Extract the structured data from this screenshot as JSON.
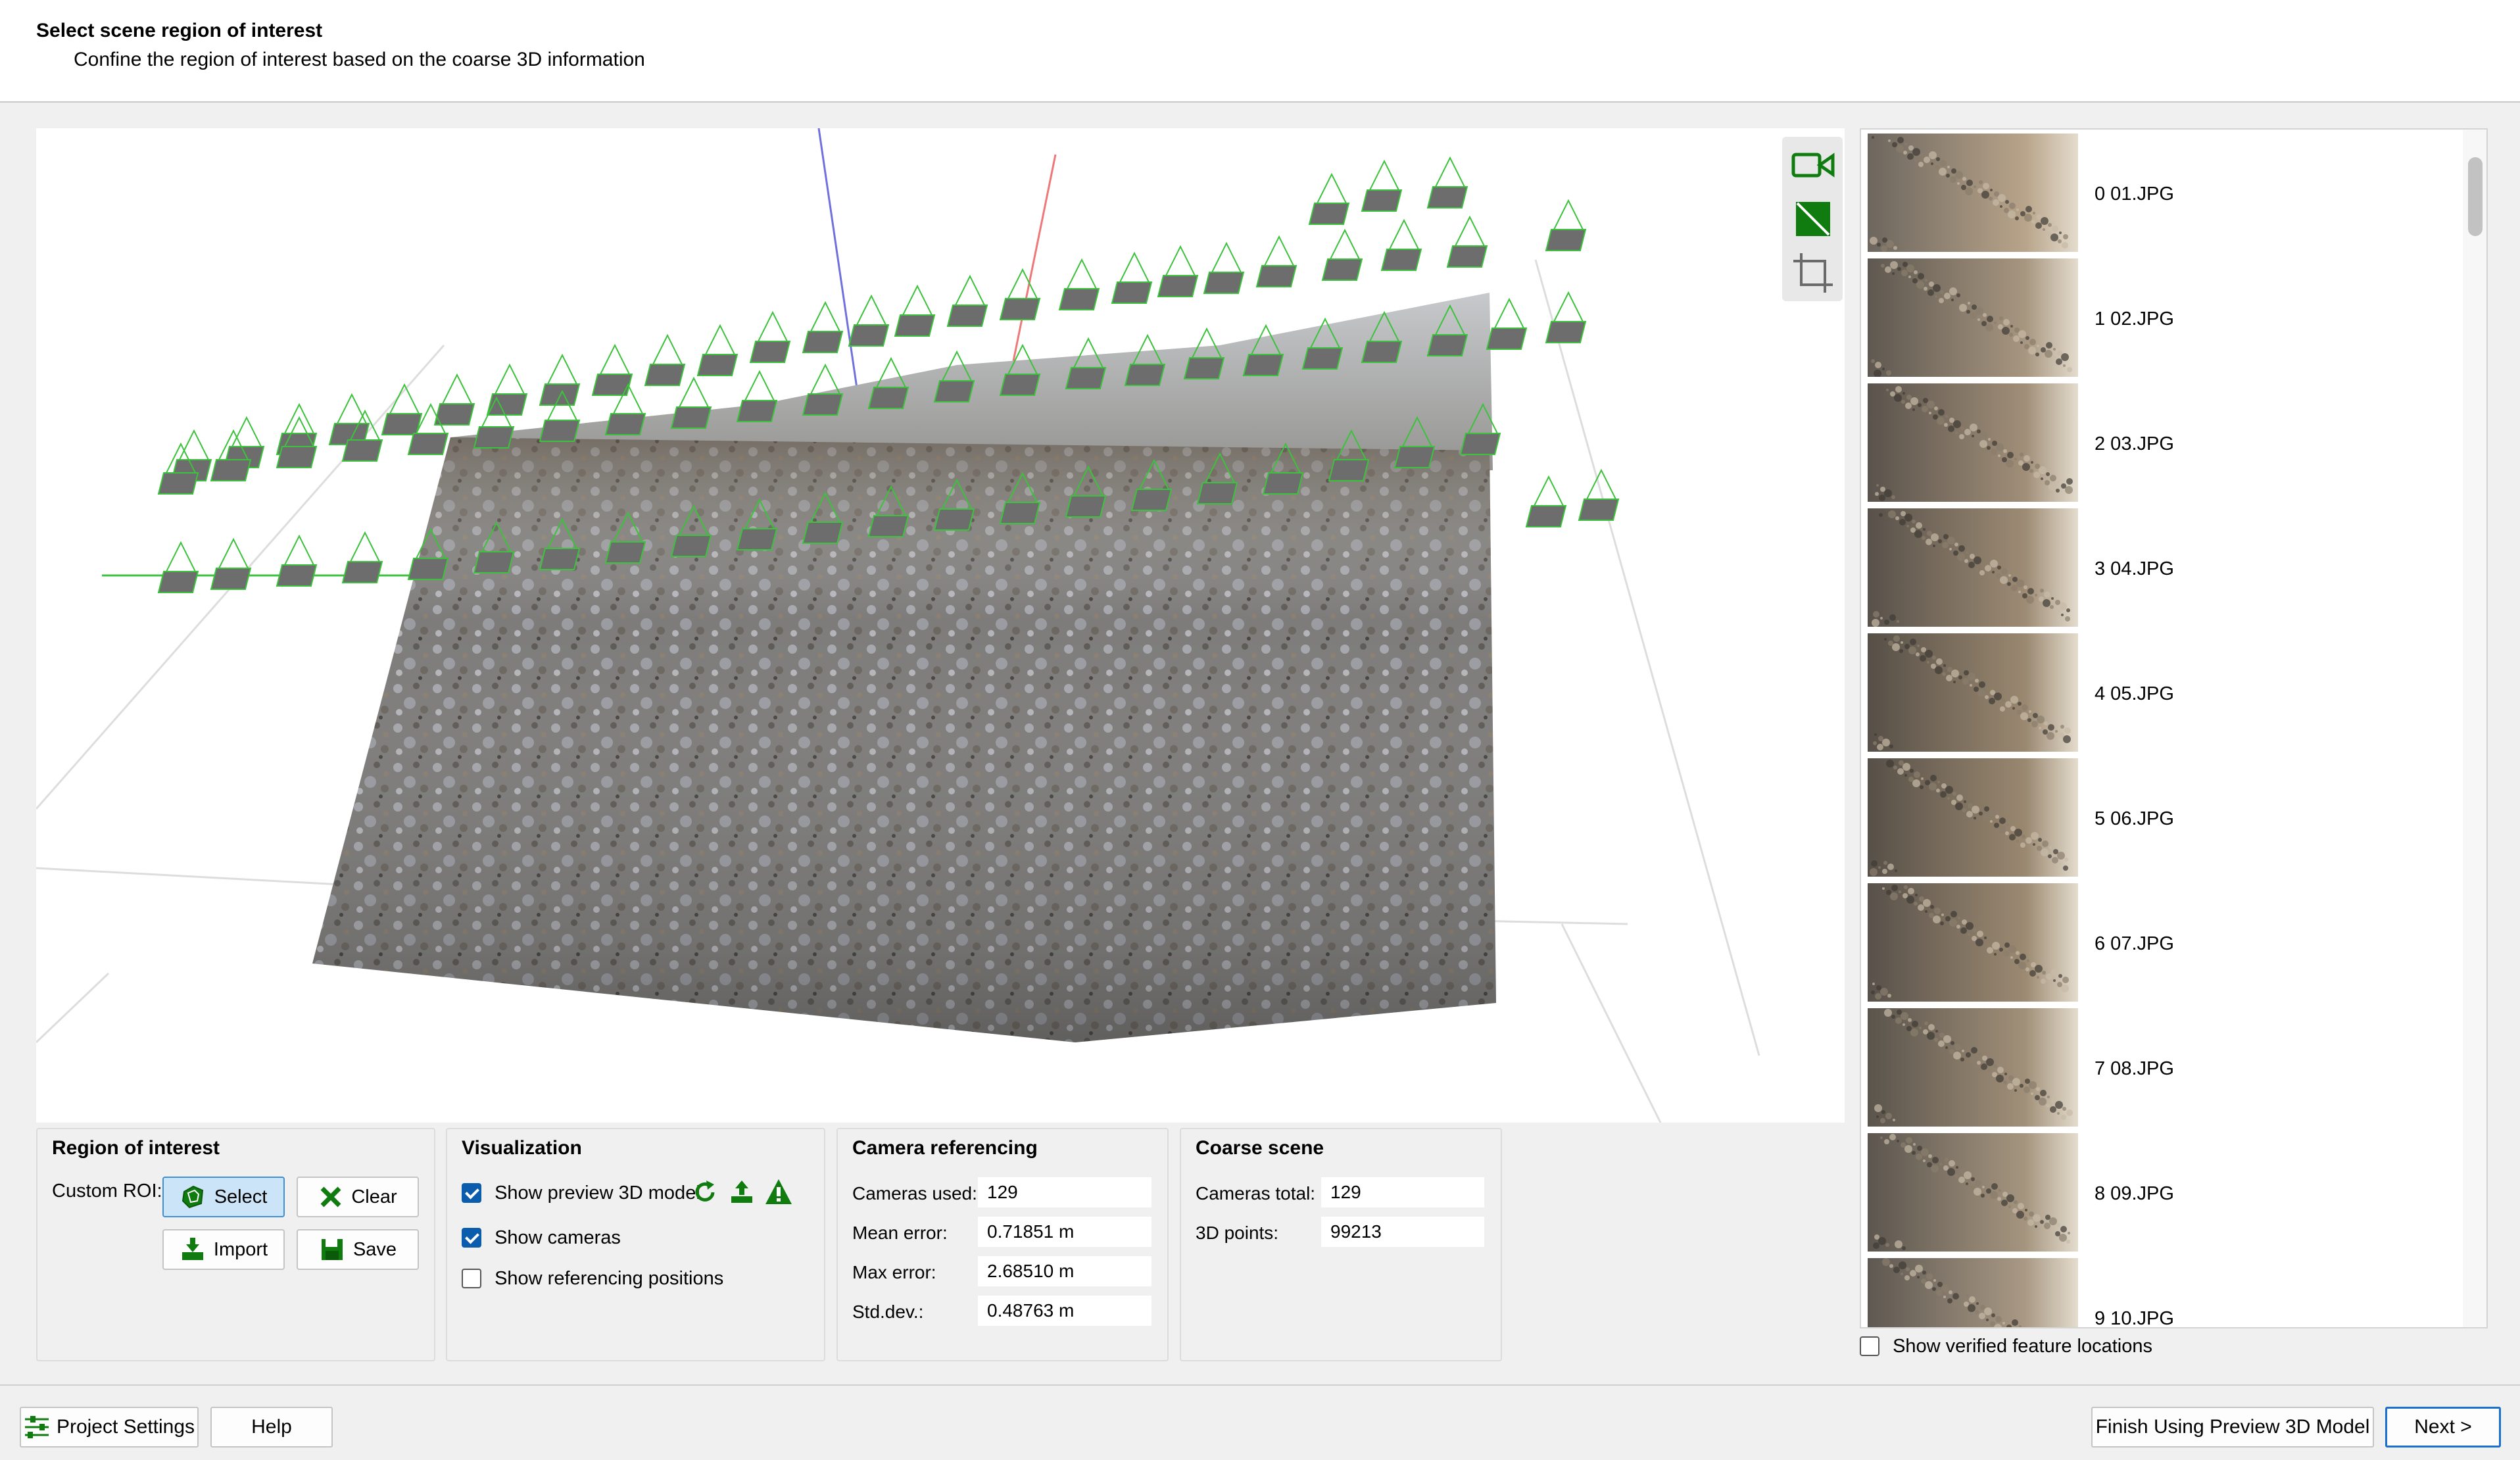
{
  "header": {
    "title": "Select scene region of interest",
    "subtitle": "Confine the region of interest based on the coarse 3D information"
  },
  "view_tools": [
    {
      "name": "camera-view-icon"
    },
    {
      "name": "toggle-model-icon"
    },
    {
      "name": "crop-box-icon"
    }
  ],
  "thumbnails": [
    {
      "label": "0 01.JPG"
    },
    {
      "label": "1 02.JPG"
    },
    {
      "label": "2 03.JPG"
    },
    {
      "label": "3 04.JPG"
    },
    {
      "label": "4 05.JPG"
    },
    {
      "label": "5 06.JPG"
    },
    {
      "label": "6 07.JPG"
    },
    {
      "label": "7 08.JPG"
    },
    {
      "label": "8 09.JPG"
    },
    {
      "label": "9 10.JPG"
    }
  ],
  "show_verified": {
    "label": "Show verified feature locations",
    "checked": false
  },
  "roi": {
    "title": "Region of interest",
    "custom_label": "Custom ROI:",
    "select": "Select",
    "clear": "Clear",
    "import": "Import",
    "save": "Save"
  },
  "visualization": {
    "title": "Visualization",
    "preview_model": {
      "label": "Show preview 3D model",
      "checked": true
    },
    "cameras": {
      "label": "Show cameras",
      "checked": true
    },
    "referencing": {
      "label": "Show referencing positions",
      "checked": false
    }
  },
  "camera_ref": {
    "title": "Camera referencing",
    "used_label": "Cameras used:",
    "used": "129",
    "mean_label": "Mean error:",
    "mean": "0.71851 m",
    "max_label": "Max error:",
    "max": "2.68510 m",
    "std_label": "Std.dev.:",
    "std": "0.48763 m"
  },
  "coarse": {
    "title": "Coarse scene",
    "total_label": "Cameras total:",
    "total": "129",
    "points_label": "3D points:",
    "points": "99213"
  },
  "footer": {
    "project_settings": "Project Settings",
    "help": "Help",
    "finish": "Finish Using Preview 3D Model",
    "next": "Next >"
  },
  "colors": {
    "accent_green": "#107c10",
    "camera_green": "#3cc23c",
    "active_blue": "#cce4f7"
  }
}
